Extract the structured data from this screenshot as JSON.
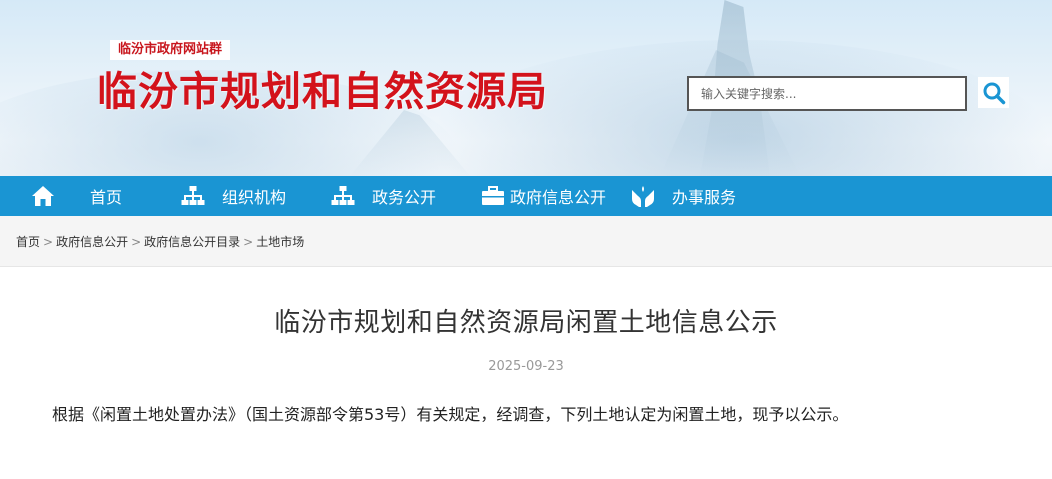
{
  "header": {
    "group_badge": "临汾市政府网站群",
    "site_title": "临汾市规划和自然资源局",
    "search_placeholder": "输入关键字搜索...",
    "colors": {
      "title_red": "#d3121b",
      "nav_blue": "#1a95d3"
    }
  },
  "nav": {
    "items": [
      {
        "label": "首页",
        "icon": "home-icon"
      },
      {
        "label": "组织机构",
        "icon": "org-chart-icon"
      },
      {
        "label": "政务公开",
        "icon": "org-chart-icon"
      },
      {
        "label": "政府信息公开",
        "icon": "briefcase-icon"
      },
      {
        "label": "办事服务",
        "icon": "hands-service-icon"
      }
    ]
  },
  "breadcrumb": {
    "items": [
      "首页",
      "政府信息公开",
      "政府信息公开目录",
      "土地市场"
    ],
    "separator": ">"
  },
  "article": {
    "title": "临汾市规划和自然资源局闲置土地信息公示",
    "date": "2025-09-23",
    "body": "根据《闲置土地处置办法》（国土资源部令第53号）有关规定，经调查，下列土地认定为闲置土地，现予以公示。"
  }
}
